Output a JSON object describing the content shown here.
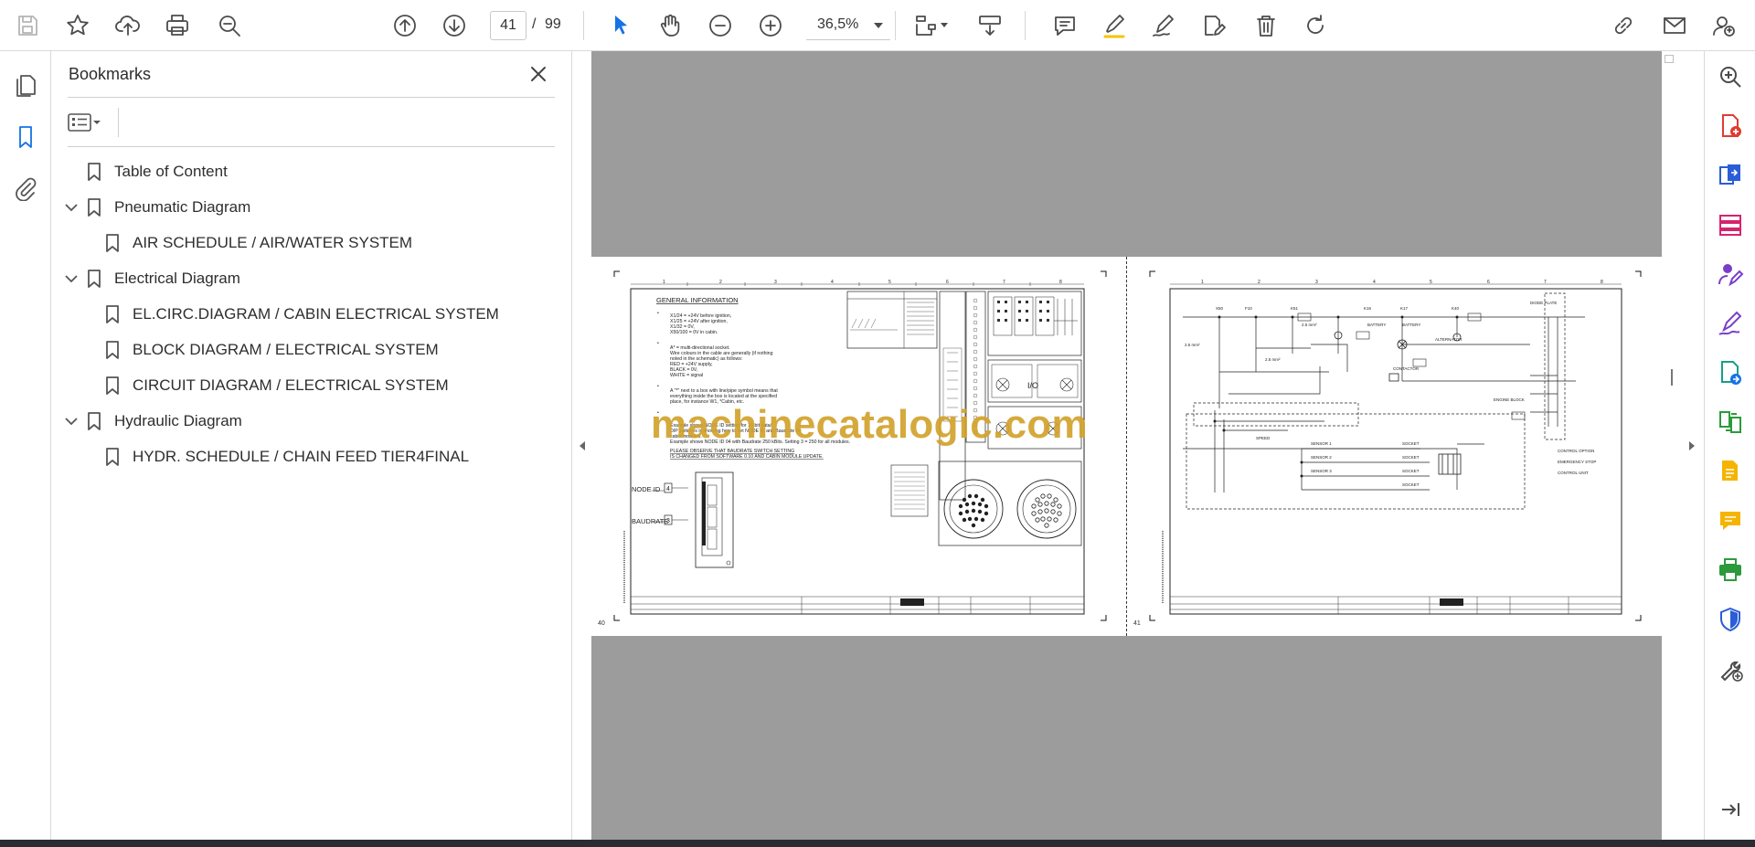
{
  "toolbar": {
    "page_current": "41",
    "page_separator": "/",
    "page_total": "99",
    "zoom": "36,5%",
    "left_icons": [
      "save-icon",
      "star-icon",
      "upload-icon",
      "print-icon",
      "zoom-search-icon"
    ],
    "nav_icons": [
      "prev-page-icon",
      "next-page-icon"
    ],
    "tools": [
      "select-cursor-icon",
      "hand-icon",
      "zoom-out-icon",
      "zoom-in-icon",
      "page-fit-icon",
      "scroll-mode-icon"
    ],
    "annotate": [
      "comment-icon",
      "highlight-icon",
      "sign-pen-icon",
      "edit-text-icon",
      "delete-icon",
      "rotate-icon"
    ],
    "right_icons": [
      "share-link-icon",
      "email-icon",
      "account-icon"
    ]
  },
  "sidebar": {
    "items": [
      "pages-icon",
      "bookmarks-icon",
      "attachments-icon"
    ],
    "active": "bookmarks-icon"
  },
  "bookmarks": {
    "title": "Bookmarks",
    "items": [
      {
        "label": "Table of Content",
        "level": 0,
        "expanded": null
      },
      {
        "label": "Pneumatic Diagram",
        "level": 0,
        "expanded": true
      },
      {
        "label": "AIR SCHEDULE / AIR/WATER SYSTEM",
        "level": 1,
        "expanded": null
      },
      {
        "label": "Electrical Diagram",
        "level": 0,
        "expanded": true
      },
      {
        "label": "EL.CIRC.DIAGRAM / CABIN ELECTRICAL SYSTEM",
        "level": 1,
        "expanded": null
      },
      {
        "label": "BLOCK DIAGRAM / ELECTRICAL SYSTEM",
        "level": 1,
        "expanded": null
      },
      {
        "label": "CIRCUIT DIAGRAM / ELECTRICAL SYSTEM",
        "level": 1,
        "expanded": null
      },
      {
        "label": "Hydraulic Diagram",
        "level": 0,
        "expanded": true
      },
      {
        "label": "HYDR. SCHEDULE / CHAIN FEED TIER4FINAL",
        "level": 1,
        "expanded": null
      }
    ]
  },
  "document": {
    "watermark": "machinecatalogic.com",
    "left_page": {
      "number": "40",
      "heading": "GENERAL INFORMATION",
      "node_label": "NODE ID",
      "node_value": "4",
      "baudrate_label": "BAUDRATE",
      "baudrate_value": "3",
      "io_label": "I/O"
    },
    "right_page": {
      "number": "41"
    }
  },
  "right_tools": [
    "search-zoom-icon",
    "create-pdf-icon",
    "export-pdf-icon",
    "organize-pages-icon",
    "request-signature-icon",
    "fill-sign-icon",
    "convert-pdf-icon",
    "compare-files-icon",
    "edit-pdf-icon",
    "comment-tool-icon",
    "print-production-icon",
    "protect-icon",
    "more-tools-icon"
  ],
  "colors": {
    "accent": "#1473e6",
    "watermark": "#d2a22c",
    "viewer_background": "#9c9c9c"
  }
}
